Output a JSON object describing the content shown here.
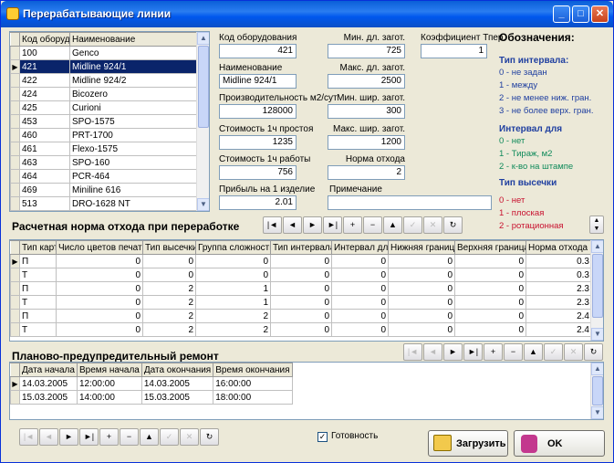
{
  "window": {
    "title": "Перерабатывающие линии"
  },
  "equipment_grid": {
    "headers": [
      "Код оборуд",
      "Наименование"
    ],
    "rows": [
      [
        "100",
        "Genco"
      ],
      [
        "421",
        "Midline 924/1"
      ],
      [
        "422",
        "Midline 924/2"
      ],
      [
        "424",
        "Bicozero"
      ],
      [
        "425",
        "Curioni"
      ],
      [
        "453",
        "SPO-1575"
      ],
      [
        "460",
        "PRT-1700"
      ],
      [
        "461",
        "Flexo-1575"
      ],
      [
        "463",
        "SPO-160"
      ],
      [
        "464",
        "PCR-464"
      ],
      [
        "469",
        "Miniline 616"
      ],
      [
        "513",
        "DRO-1628 NT"
      ]
    ],
    "selected_index": 1
  },
  "form": {
    "code_label": "Код оборудования",
    "code_value": "421",
    "name_label": "Наименование",
    "name_value": "Midline 924/1",
    "productivity_label": "Производительность м2/сут",
    "productivity_value": "128000",
    "idle_cost_label": "Стоимость 1ч простоя",
    "idle_cost_value": "1235",
    "work_cost_label": "Стоимость 1ч работы",
    "work_cost_value": "756",
    "profit_label": "Прибыль на 1 изделие",
    "profit_value": "2.01",
    "min_len_label": "Мин. дл. загот.",
    "min_len_value": "725",
    "max_len_label": "Макс. дл. загот.",
    "max_len_value": "2500",
    "min_wid_label": "Мин. шир. загот.",
    "min_wid_value": "300",
    "max_wid_label": "Макс. шир. загот.",
    "max_wid_value": "1200",
    "waste_norm_label": "Норма отхода",
    "waste_norm_value": "2",
    "coef_label": "Коэффициент Тпер.",
    "coef_value": "1",
    "note_label": "Примечание",
    "note_value": ""
  },
  "legend": {
    "title": "Обозначения:",
    "interval_type_title": "Тип интервала:",
    "interval_type_items": [
      "0 - не задан",
      "1 - между",
      "2 - не менее ниж. гран.",
      "3 - не более верх. гран."
    ],
    "interval_for_title": "Интервал для",
    "interval_for_items": [
      "0 - нет",
      "1 - Тираж, м2",
      "2 - к-во на штампе"
    ],
    "cut_type_title": "Тип высечки",
    "cut_type_items": [
      "0 - нет",
      "1 - плоская",
      "2 - ротационная"
    ]
  },
  "waste_section": {
    "title": "Расчетная норма отхода при переработке",
    "headers": [
      "Тип карт",
      "Число цветов печати",
      "Тип высечки",
      "Группа сложности",
      "Тип интервала",
      "Интервал для",
      "Нижняя граница",
      "Верхняя граница",
      "Норма отхода"
    ],
    "rows": [
      [
        "П",
        "0",
        "0",
        "0",
        "0",
        "0",
        "0",
        "0",
        "0.3"
      ],
      [
        "Т",
        "0",
        "0",
        "0",
        "0",
        "0",
        "0",
        "0",
        "0.3"
      ],
      [
        "П",
        "0",
        "2",
        "1",
        "0",
        "0",
        "0",
        "0",
        "2.3"
      ],
      [
        "Т",
        "0",
        "2",
        "1",
        "0",
        "0",
        "0",
        "0",
        "2.3"
      ],
      [
        "П",
        "0",
        "2",
        "2",
        "0",
        "0",
        "0",
        "0",
        "2.4"
      ],
      [
        "Т",
        "0",
        "2",
        "2",
        "0",
        "0",
        "0",
        "0",
        "2.4"
      ]
    ]
  },
  "repair_section": {
    "title": "Планово-предупредительный ремонт",
    "headers": [
      "Дата начала",
      "Время начала",
      "Дата окончания",
      "Время окончания"
    ],
    "rows": [
      [
        "14.03.2005",
        "12:00:00",
        "14.03.2005",
        "16:00:00"
      ],
      [
        "15.03.2005",
        "14:00:00",
        "15.03.2005",
        "18:00:00"
      ]
    ]
  },
  "nav": {
    "first": "|◄",
    "prev": "◄",
    "next": "►",
    "last": "►|",
    "add": "+",
    "delete": "−",
    "up": "▲",
    "post": "✓",
    "cancel": "✕",
    "refresh": "↻"
  },
  "footer": {
    "ready_label": "Готовность",
    "ready_checked": "✓",
    "load_label": "Загрузить",
    "ok_label": "OK"
  }
}
